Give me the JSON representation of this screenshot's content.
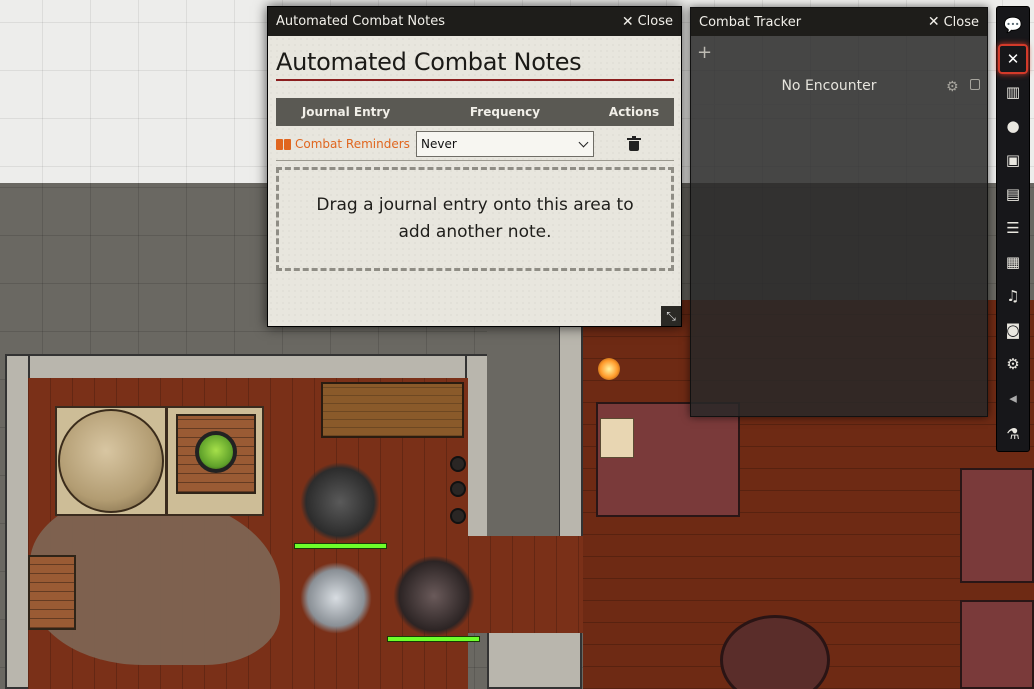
{
  "acn_window": {
    "header_title": "Automated Combat Notes",
    "close_label": "Close",
    "title": "Automated Combat Notes",
    "columns": [
      "Journal Entry",
      "Frequency",
      "Actions"
    ],
    "rows": [
      {
        "journal_entry": "Combat Reminders",
        "frequency": "Never"
      }
    ],
    "drop_hint": "Drag a journal entry onto this area to add another note."
  },
  "combat_tracker": {
    "header_title": "Combat Tracker",
    "close_label": "Close",
    "add_symbol": "+",
    "status_text": "No Encounter"
  },
  "toolbar": {
    "tabs": [
      {
        "name": "chat",
        "icon": "chat-bubbles-icon"
      },
      {
        "name": "combat",
        "icon": "crossed-swords-icon",
        "active": true
      },
      {
        "name": "scenes",
        "icon": "map-icon"
      },
      {
        "name": "actors",
        "icon": "user-icon"
      },
      {
        "name": "items",
        "icon": "suitcase-icon"
      },
      {
        "name": "journal",
        "icon": "book-icon"
      },
      {
        "name": "tables",
        "icon": "table-list-icon"
      },
      {
        "name": "cards",
        "icon": "cards-icon"
      },
      {
        "name": "playlists",
        "icon": "music-icon"
      },
      {
        "name": "compendium",
        "icon": "atlas-icon"
      },
      {
        "name": "settings",
        "icon": "cogs-icon"
      },
      {
        "name": "collapse",
        "icon": "caret-left-icon"
      },
      {
        "name": "macros",
        "icon": "flask-icon"
      }
    ]
  },
  "colors": {
    "header": "#1e1d1a",
    "accent_link": "#e0661f",
    "title_rule": "#8b1e1e",
    "active_tab": "#d33a2a",
    "hp_bar": "#6dff2a"
  }
}
